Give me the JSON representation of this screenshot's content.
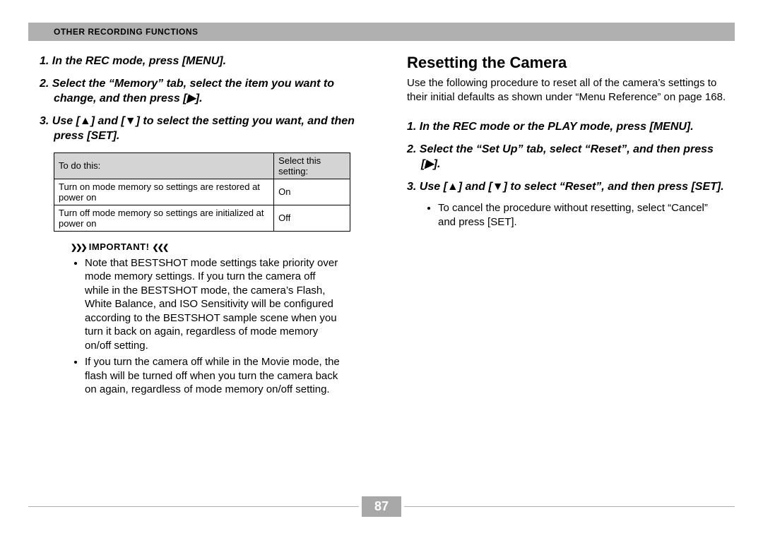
{
  "header": {
    "section_title": "Other Recording Functions"
  },
  "left": {
    "steps": [
      "In the REC mode, press [MENU].",
      "Select the “Memory” tab, select the item you want to change, and then press [▶].",
      "Use [▲] and [▼] to select the setting you want, and then press [SET]."
    ],
    "table": {
      "head": {
        "c1": "To do this:",
        "c2": "Select this setting:"
      },
      "rows": [
        {
          "c1": "Turn on mode memory so settings are restored at power on",
          "c2": "On"
        },
        {
          "c1": "Turn off mode memory so settings are initialized at power on",
          "c2": "Off"
        }
      ]
    },
    "important_label": "IMPORTANT!",
    "important_bullets": [
      "Note that BESTSHOT mode settings take priority over mode memory settings. If you turn the camera off while in the BESTSHOT mode, the camera’s Flash, White Balance, and ISO Sensitivity will be configured according to the BESTSHOT sample scene when you turn it back on again, regardless of mode memory on/off setting.",
      "If you turn the camera off while in the Movie mode, the flash will be turned off when you turn the camera back on again, regardless of mode memory on/off setting."
    ]
  },
  "right": {
    "heading": "Resetting the Camera",
    "intro": "Use the following procedure to reset all of the camera’s settings to their initial defaults as shown under “Menu Reference” on page 168.",
    "steps": [
      "In the REC mode or the PLAY mode, press [MENU].",
      "Select the “Set Up” tab, select “Reset”, and then press [▶].",
      "Use [▲] and [▼] to select “Reset”, and then press [SET]."
    ],
    "sub_bullet": "To cancel the procedure without resetting, select “Cancel” and press [SET]."
  },
  "page_number": "87"
}
